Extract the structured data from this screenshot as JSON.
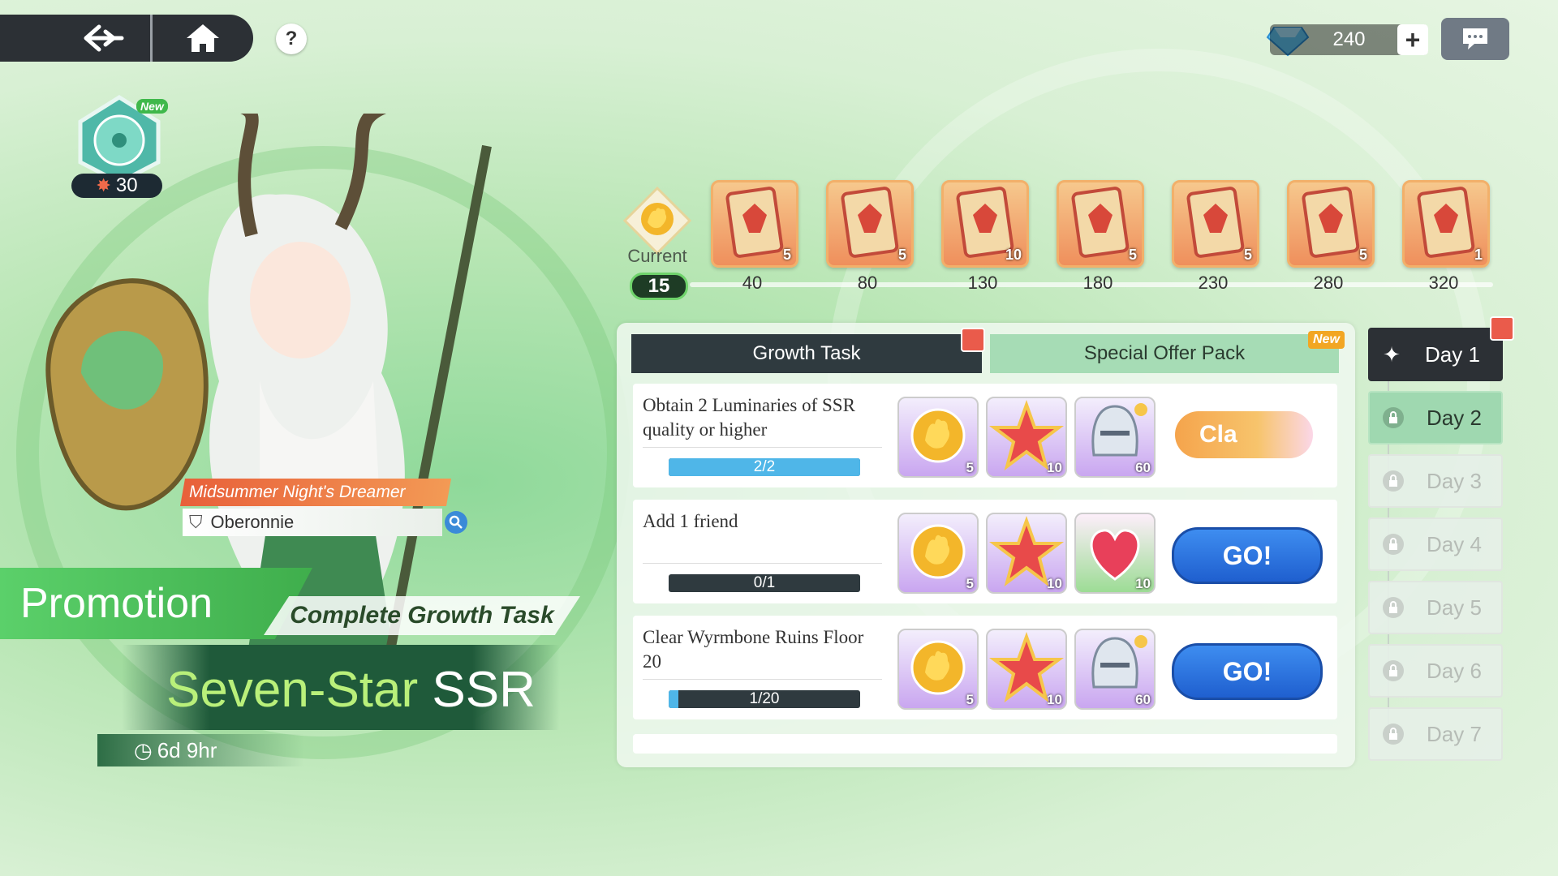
{
  "nav": {
    "help": "?"
  },
  "currency": {
    "gems": "240",
    "plus": "+"
  },
  "badge": {
    "new": "New",
    "count": "30"
  },
  "character": {
    "title": "Midsummer Night's Dreamer",
    "name": "Oberonnie"
  },
  "banner": {
    "promotion": "Promotion",
    "subtitle": "Complete Growth Task",
    "ssr_prefix": "Seven-Star",
    "ssr_suffix": "SSR",
    "timer": "6d 9hr"
  },
  "progress": {
    "current_label": "Current",
    "current_value": "15",
    "milestones": [
      {
        "points": "40",
        "qty": "5"
      },
      {
        "points": "80",
        "qty": "5"
      },
      {
        "points": "130",
        "qty": "10"
      },
      {
        "points": "180",
        "qty": "5"
      },
      {
        "points": "230",
        "qty": "5"
      },
      {
        "points": "280",
        "qty": "5"
      },
      {
        "points": "320",
        "qty": "1"
      }
    ]
  },
  "tabs": {
    "growth": "Growth Task",
    "special": "Special Offer Pack",
    "new_tag": "New"
  },
  "tasks": [
    {
      "text": "Obtain 2 Luminaries of SSR quality or higher",
      "progress": "2/2",
      "fill": 1.0,
      "rewards": [
        {
          "icon": "hand-icon",
          "qty": "5"
        },
        {
          "icon": "star-icon",
          "qty": "10"
        },
        {
          "icon": "knight-icon",
          "qty": "60"
        }
      ],
      "button": "Cla"
    },
    {
      "text": "Add 1 friend",
      "progress": "0/1",
      "fill": 0.0,
      "rewards": [
        {
          "icon": "hand-icon",
          "qty": "5"
        },
        {
          "icon": "star-icon",
          "qty": "10"
        },
        {
          "icon": "heart-icon",
          "qty": "10"
        }
      ],
      "button": "GO!"
    },
    {
      "text": "Clear Wyrmbone Ruins Floor 20",
      "progress": "1/20",
      "fill": 0.05,
      "rewards": [
        {
          "icon": "hand-icon",
          "qty": "5"
        },
        {
          "icon": "star-icon",
          "qty": "10"
        },
        {
          "icon": "knight-icon",
          "qty": "60"
        }
      ],
      "button": "GO!"
    }
  ],
  "days": [
    "Day 1",
    "Day 2",
    "Day 3",
    "Day 4",
    "Day 5",
    "Day 6",
    "Day 7"
  ],
  "colors": {
    "accent_blue": "#1f5fcf",
    "panel_dark": "#2f3a3f",
    "tab_green": "#a6dcb5"
  }
}
